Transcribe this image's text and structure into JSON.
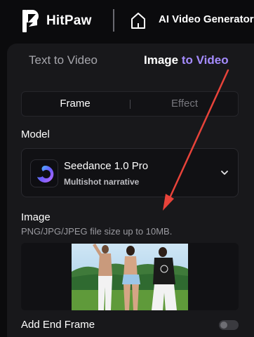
{
  "topbar": {
    "brand_name": "HitPaw",
    "tool_title": "AI Video Generator"
  },
  "mode_tabs": {
    "text_to_video": "Text to Video",
    "image_to_video_part1": "Image ",
    "image_to_video_part2": "to Video",
    "active": "Image to Video"
  },
  "sub_tabs": {
    "frame": "Frame",
    "effect": "Effect",
    "active": "Frame"
  },
  "model": {
    "label": "Model",
    "name": "Seedance 1.0 Pro",
    "subtitle": "Multishot narrative"
  },
  "image": {
    "label": "Image",
    "hint": "PNG/JPG/JPEG file size up to 10MB."
  },
  "end_frame": {
    "label": "Add End Frame",
    "enabled": false
  },
  "colors": {
    "accent": "#a58cff",
    "annotation_arrow": "#e8433a",
    "background": "#0b0b0d",
    "panel": "#18181b"
  }
}
